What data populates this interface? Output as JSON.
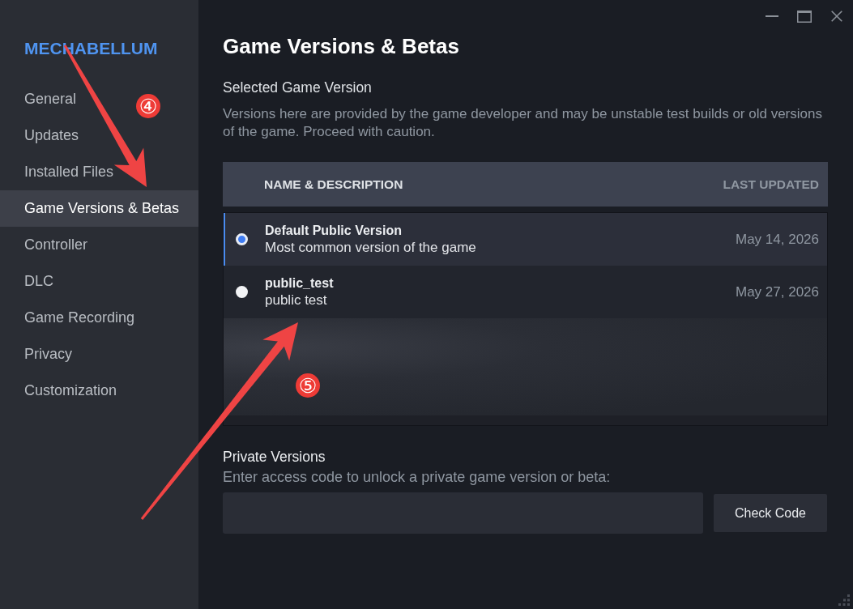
{
  "sidebar": {
    "game_title": "MECHABELLUM",
    "items": [
      {
        "label": "General",
        "selected": false
      },
      {
        "label": "Updates",
        "selected": false
      },
      {
        "label": "Installed Files",
        "selected": false
      },
      {
        "label": "Game Versions & Betas",
        "selected": true
      },
      {
        "label": "Controller",
        "selected": false
      },
      {
        "label": "DLC",
        "selected": false
      },
      {
        "label": "Game Recording",
        "selected": false
      },
      {
        "label": "Privacy",
        "selected": false
      },
      {
        "label": "Customization",
        "selected": false
      }
    ]
  },
  "page": {
    "title": "Game Versions & Betas",
    "section_title": "Selected Game Version",
    "description": "Versions here are provided by the game developer and may be unstable test builds or old versions of the game. Proceed with caution.",
    "table": {
      "columns": [
        "NAME & DESCRIPTION",
        "LAST UPDATED"
      ],
      "rows": [
        {
          "name": "Default Public Version",
          "description": "Most common version of the game",
          "last_updated": "May 14, 2026",
          "selected": true
        },
        {
          "name": "public_test",
          "description": "public test",
          "last_updated": "May 27, 2026",
          "selected": false
        }
      ]
    },
    "private_versions": {
      "title": "Private Versions",
      "hint": "Enter access code to unlock a private game version or beta:",
      "button": "Check Code"
    }
  },
  "annotations": [
    {
      "label": "④"
    },
    {
      "label": "⑤"
    }
  ]
}
